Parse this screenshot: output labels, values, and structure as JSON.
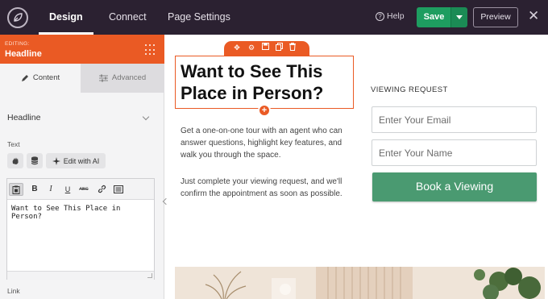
{
  "topbar": {
    "tabs": [
      {
        "label": "Design",
        "active": true
      },
      {
        "label": "Connect",
        "active": false
      },
      {
        "label": "Page Settings",
        "active": false
      }
    ],
    "help_label": "Help",
    "save_label": "Save",
    "preview_label": "Preview",
    "icons": [
      "seedprod-logo-icon",
      "help-icon",
      "save-dropdown-icon",
      "close-icon"
    ]
  },
  "panel": {
    "editing_label": "EDITING:",
    "editing_title": "Headline",
    "tabs": {
      "content": "Content",
      "advanced": "Advanced"
    },
    "section_title": "Headline",
    "text_label": "Text",
    "edit_with_ai": "Edit with AI",
    "editor_text": "Want to See This Place in Person?",
    "toolbar": {
      "bold": "B",
      "italic": "I",
      "underline": "U",
      "strike": "ABC"
    },
    "link_label": "Link"
  },
  "canvas": {
    "headline": "Want to See This Place in Person?",
    "paragraph_1": "Get a one-on-one tour with an agent who can answer questions, highlight key features, and walk you through the space.",
    "paragraph_2": "Just complete your viewing request, and we'll confirm the appointment as soon as possible.",
    "form": {
      "label": "VIEWING REQUEST",
      "email_placeholder": "Enter Your Email",
      "name_placeholder": "Enter Your Name",
      "button_label": "Book a Viewing"
    }
  },
  "colors": {
    "topbar_bg": "#2b2131",
    "accent_orange": "#ea5a24",
    "save_green": "#1e9d60",
    "book_button_green": "#4a9a71"
  }
}
